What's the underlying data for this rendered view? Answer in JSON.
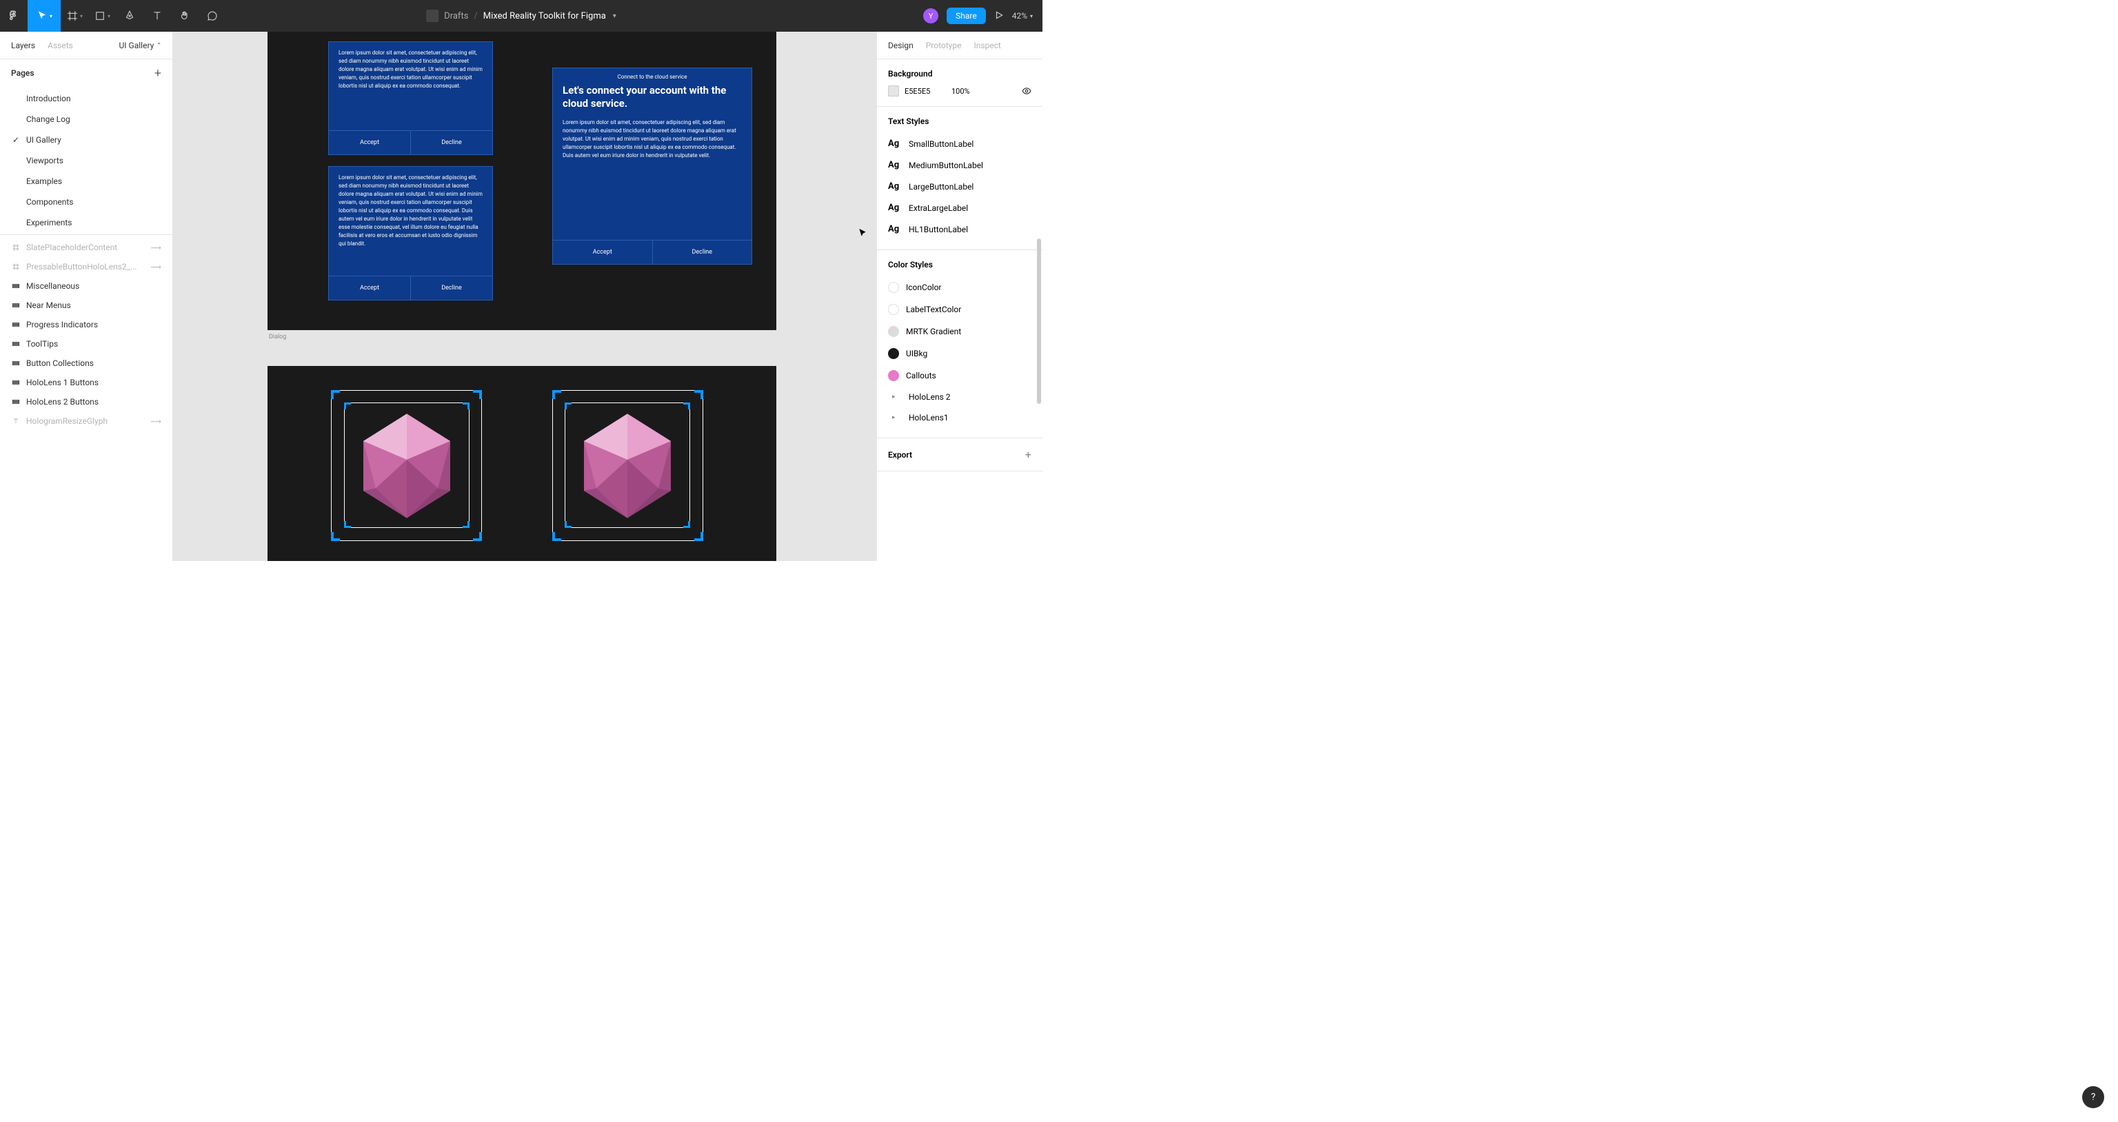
{
  "toolbar": {
    "drafts": "Drafts",
    "title": "Mixed Reality Toolkit for Figma",
    "avatar": "Y",
    "share": "Share",
    "zoom": "42%"
  },
  "left": {
    "tab_layers": "Layers",
    "tab_assets": "Assets",
    "page_selector": "UI Gallery",
    "pages_head": "Pages",
    "pages": [
      {
        "label": "Introduction"
      },
      {
        "label": "Change Log"
      },
      {
        "label": "UI Gallery",
        "selected": true
      },
      {
        "label": "Viewports"
      },
      {
        "label": "Examples"
      },
      {
        "label": "Components"
      },
      {
        "label": "Experiments"
      }
    ],
    "layers": [
      {
        "label": "SlatePlaceholderContent",
        "icon": "frame",
        "dim": true,
        "reveal": true
      },
      {
        "label": "PressableButtonHoloLens2_...",
        "icon": "frame",
        "dim": true,
        "reveal": true
      },
      {
        "label": "Miscellaneous",
        "icon": "section"
      },
      {
        "label": "Near Menus",
        "icon": "section"
      },
      {
        "label": "Progress Indicators",
        "icon": "section"
      },
      {
        "label": "ToolTips",
        "icon": "section"
      },
      {
        "label": "Button Collections",
        "icon": "section"
      },
      {
        "label": "HoloLens 1 Buttons",
        "icon": "section"
      },
      {
        "label": "HoloLens 2 Buttons",
        "icon": "section"
      },
      {
        "label": "HologramResizeGlyph",
        "icon": "text",
        "dim": true,
        "reveal": true
      }
    ]
  },
  "canvas": {
    "frame_label_1": "Dialog",
    "dialog1_body": "Lorem ipsum dolor sit amet, consectetuer adipiscing elit, sed diam nonummy nibh euismod tincidunt ut laoreet dolore magna aliquam erat volutpat. Ut wisi enim ad minim veniam, quis nostrud exerci tation ullamcorper suscipit lobortis nisl ut aliquip ex ea commodo consequat.",
    "dialog2_body": "Lorem ipsum dolor sit amet, consectetuer adipiscing elit, sed diam nonummy nibh euismod tincidunt ut laoreet dolore magna aliquam erat volutpat. Ut wisi enim ad minim veniam, quis nostrud exerci tation ullamcorper suscipit lobortis nisl ut aliquip ex ea commodo consequat. Duis autem vel eum iriure dolor in hendrerit in vulputate velit esse molestie consequat, vel illum dolore eu feugiat nulla facilisis at vero eros et accumsan et iusto odio dignissim qui blandit.",
    "dialog3_overline": "Connect to the cloud service",
    "dialog3_title": "Let's connect your account with the cloud service.",
    "dialog3_body": "Lorem ipsum dolor sit amet, consectetuer adipiscing elit, sed diam nonummy nibh euismod tincidunt ut laoreet dolore magna aliquam erat volutpat. Ut wisi enim ad minim veniam, quis nostrud exerci tation ullamcorper suscipit lobortis nisl ut aliquip ex ea commodo consequat. Duis autem vel eum iriure dolor in hendrerit in vulputate velit.",
    "btn_accept": "Accept",
    "btn_decline": "Decline"
  },
  "right": {
    "tab_design": "Design",
    "tab_prototype": "Prototype",
    "tab_inspect": "Inspect",
    "bg_head": "Background",
    "bg_hex": "E5E5E5",
    "bg_pct": "100%",
    "ts_head": "Text Styles",
    "text_styles": [
      "SmallButtonLabel",
      "MediumButtonLabel",
      "LargeButtonLabel",
      "ExtraLargeLabel",
      "HL1ButtonLabel"
    ],
    "cs_head": "Color Styles",
    "color_styles": [
      {
        "label": "IconColor",
        "color": "#ffffff",
        "border": "#ddd"
      },
      {
        "label": "LabelTextColor",
        "color": "#ffffff",
        "border": "#ddd"
      },
      {
        "label": "MRTK Gradient",
        "color": "linear-gradient(135deg,#e8d0dd,#d0e8d5)"
      },
      {
        "label": "UIBkg",
        "color": "#1a1a1a"
      },
      {
        "label": "Callouts",
        "color": "#e879c7"
      }
    ],
    "folders": [
      "HoloLens 2",
      "HoloLens1"
    ],
    "export": "Export"
  },
  "help": "?"
}
